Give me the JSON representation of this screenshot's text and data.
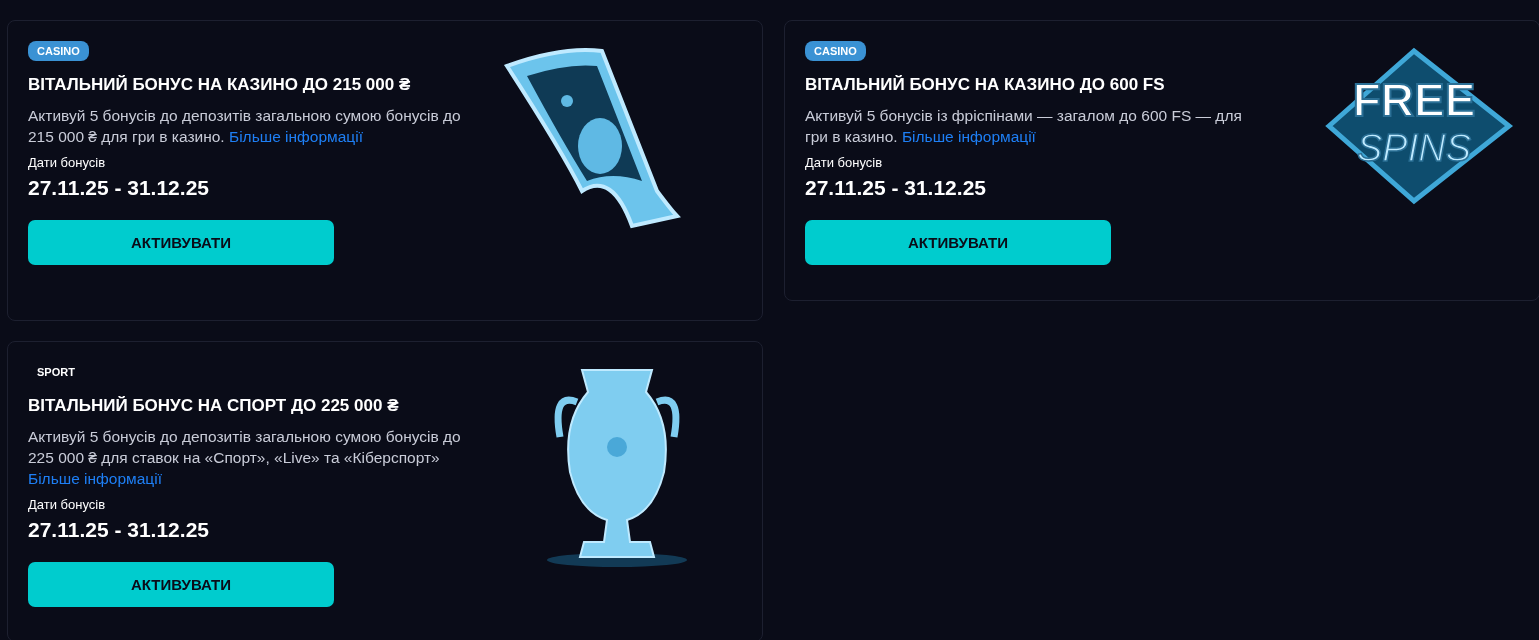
{
  "cards": [
    {
      "kind": "casino",
      "tag": "CASINO",
      "title": "ВІТАЛЬНИЙ БОНУС НА КАЗИНО ДО 215 000 ₴",
      "description": "Активуй 5 бонусів до депозитів загальною сумою бонусів до 215 000 ₴ для гри в казино.",
      "link": "Більше інформації",
      "dates_label": "Дати бонусів",
      "dates": "27.11.25 - 31.12.25",
      "button": "АКТИВУВАТИ",
      "art": {
        "kind": "banknote"
      }
    },
    {
      "kind": "casino",
      "tag": "CASINO",
      "title": "ВІТАЛЬНИЙ БОНУС НА КАЗИНО ДО 600 FS",
      "description": "Активуй 5 бонусів із фріспінами — загалом до 600 FS — для гри в казино.",
      "link": "Більше інформації",
      "dates_label": "Дати бонусів",
      "dates": "27.11.25 - 31.12.25",
      "button": "АКТИВУВАТИ",
      "art": {
        "kind": "free-spins",
        "lines": [
          "FREE",
          "SPINS"
        ]
      }
    },
    {
      "kind": "sport",
      "tag": "SPORT",
      "title": "ВІТАЛЬНИЙ БОНУС НА СПОРТ ДО 225 000 ₴",
      "description": "Активуй 5 бонусів до депозитів загальною сумою бонусів до 225 000 ₴ для ставок на «Спорт», «Live» та «Кіберспорт»",
      "link": "Більше інформації",
      "dates_label": "Дати бонусів",
      "dates": "27.11.25 - 31.12.25",
      "button": "АКТИВУВАТИ",
      "art": {
        "kind": "trophy"
      }
    }
  ]
}
